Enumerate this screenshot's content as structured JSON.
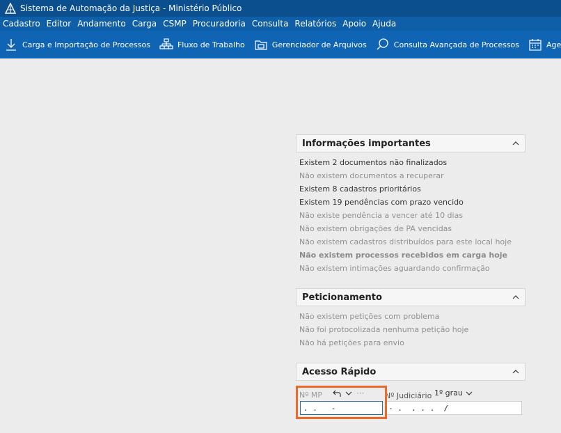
{
  "window": {
    "title": "Sistema de Automação da Justiça - Ministério Público"
  },
  "menu": [
    "Cadastro",
    "Editor",
    "Andamento",
    "Carga",
    "CSMP",
    "Procuradoria",
    "Consulta",
    "Relatórios",
    "Apoio",
    "Ajuda"
  ],
  "toolbar": [
    {
      "icon": "download-arrow-icon",
      "label": "Carga e Importação de Processos"
    },
    {
      "icon": "workflow-icon",
      "label": "Fluxo de Trabalho"
    },
    {
      "icon": "folder-icon",
      "label": "Gerenciador de Arquivos"
    },
    {
      "icon": "search-icon",
      "label": "Consulta Avançada de Processos"
    },
    {
      "icon": "calendar-icon",
      "label": "Agenda de C"
    }
  ],
  "info_panel": {
    "title": "Informações importantes",
    "items": [
      {
        "text": "Existem 2 documentos não finalizados",
        "style": "strong"
      },
      {
        "text": "Não existem documentos a recuperar",
        "style": "muted"
      },
      {
        "text": "Existem 8 cadastros prioritários",
        "style": "strong"
      },
      {
        "text": "Existem 19 pendências com prazo vencido",
        "style": "strong"
      },
      {
        "text": "Não existe pendência a vencer até 10 dias",
        "style": "muted"
      },
      {
        "text": "Não existem obrigações de PA vencidas",
        "style": "muted"
      },
      {
        "text": "Não existem cadastros distribuídos para este local hoje",
        "style": "muted"
      },
      {
        "text": "Não existem processos recebidos em carga hoje",
        "style": "bold"
      },
      {
        "text": "Não existem intimações aguardando confirmação",
        "style": "muted"
      }
    ]
  },
  "petition_panel": {
    "title": "Peticionamento",
    "items": [
      {
        "text": "Não existem petições com problema",
        "style": "muted"
      },
      {
        "text": "Não foi protocolizada nenhuma petição hoje",
        "style": "muted"
      },
      {
        "text": "Não há petições para envio",
        "style": "muted"
      }
    ]
  },
  "quick_access": {
    "title": "Acesso Rápido",
    "mp_label": "Nº MP",
    "more_label": "···",
    "judicial_label": "Nº Judiciário",
    "grau_selected": "1º grau",
    "mp_value": ". .   -",
    "judicial_value": "- .  . . .  /"
  },
  "colors": {
    "titlebar": "#0c4f8e",
    "menubar": "#0f5ea8",
    "toolbar": "#0f64b4",
    "highlight": "#ee6a2b"
  }
}
